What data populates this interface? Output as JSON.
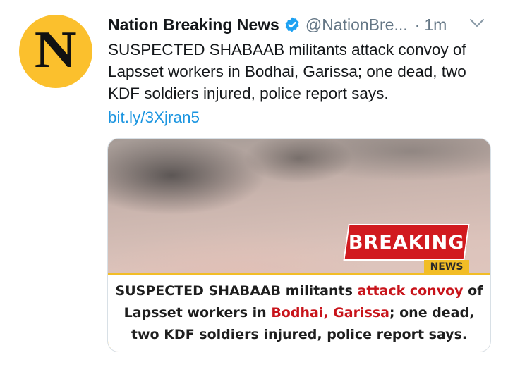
{
  "tweet": {
    "avatar_letter": "N",
    "display_name": "Nation Breaking News",
    "handle": "@NationBre...",
    "separator": "·",
    "time": "1m",
    "text": "SUSPECTED SHABAAB militants attack convoy of Lapsset workers in Bodhai, Garissa; one dead, two KDF soldiers injured, police report says.",
    "link": "bit.ly/3Xjran5"
  },
  "media": {
    "breaking_label": "BREAKING",
    "news_label": "NEWS",
    "caption": {
      "part1": "SUSPECTED SHABAAB militants ",
      "part2_red": "attack convoy",
      "part3": " of Lapsset workers in ",
      "part4_red": "Bodhai, Garissa",
      "part5": "; one dead, two KDF soldiers injured, police report says."
    }
  },
  "icons": {
    "verified": "verified-badge-icon",
    "menu": "chevron-down-icon"
  },
  "colors": {
    "avatar_bg": "#fbc02d",
    "link": "#1b95e0",
    "breaking_red": "#d11a1f",
    "news_yellow": "#f2bd26",
    "caption_red": "#c8141b",
    "secondary_text": "#657786"
  }
}
